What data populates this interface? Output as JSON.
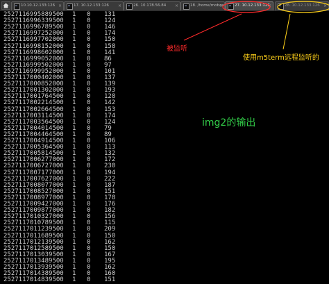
{
  "tabs": [
    {
      "label": "10.10.12.133:126",
      "active": false
    },
    {
      "label": "17. 10.12.133:126",
      "active": false
    },
    {
      "label": "26. 10.178.56.84",
      "active": false
    },
    {
      "label": "18. /home/mobaxterm",
      "active": false
    },
    {
      "label": "27. 10.12.133:126",
      "active": true
    },
    {
      "label": "28. 10.12.133.126",
      "active": false
    }
  ],
  "terminal": {
    "rows": [
      {
        "ts": "2527116995889500",
        "a": "1",
        "b": "0",
        "v": "131"
      },
      {
        "ts": "2527116996339500",
        "a": "1",
        "b": "0",
        "v": "124"
      },
      {
        "ts": "2527116996789500",
        "a": "1",
        "b": "0",
        "v": "146"
      },
      {
        "ts": "2527116997252000",
        "a": "1",
        "b": "0",
        "v": "174"
      },
      {
        "ts": "2527116997702000",
        "a": "1",
        "b": "0",
        "v": "150"
      },
      {
        "ts": "2527116998152000",
        "a": "1",
        "b": "0",
        "v": "158"
      },
      {
        "ts": "2527116998602000",
        "a": "1",
        "b": "0",
        "v": "141"
      },
      {
        "ts": "2527116999052000",
        "a": "1",
        "b": "0",
        "v": "86"
      },
      {
        "ts": "2527116999502000",
        "a": "1",
        "b": "0",
        "v": "97"
      },
      {
        "ts": "2527116999952000",
        "a": "1",
        "b": "0",
        "v": "101"
      },
      {
        "ts": "2527117000402000",
        "a": "1",
        "b": "0",
        "v": "137"
      },
      {
        "ts": "2527117000852000",
        "a": "1",
        "b": "0",
        "v": "139"
      },
      {
        "ts": "2527117001302000",
        "a": "1",
        "b": "0",
        "v": "193"
      },
      {
        "ts": "2527117001764500",
        "a": "1",
        "b": "0",
        "v": "128"
      },
      {
        "ts": "2527117002214500",
        "a": "1",
        "b": "0",
        "v": "142"
      },
      {
        "ts": "2527117002664500",
        "a": "1",
        "b": "0",
        "v": "153"
      },
      {
        "ts": "2527117003114500",
        "a": "1",
        "b": "0",
        "v": "174"
      },
      {
        "ts": "2527117003564500",
        "a": "1",
        "b": "0",
        "v": "124"
      },
      {
        "ts": "2527117004014500",
        "a": "1",
        "b": "0",
        "v": "79"
      },
      {
        "ts": "2527117004464500",
        "a": "1",
        "b": "0",
        "v": "89"
      },
      {
        "ts": "2527117004914500",
        "a": "1",
        "b": "0",
        "v": "106"
      },
      {
        "ts": "2527117005364500",
        "a": "1",
        "b": "0",
        "v": "113"
      },
      {
        "ts": "2527117005814500",
        "a": "1",
        "b": "0",
        "v": "132"
      },
      {
        "ts": "2527117006277000",
        "a": "1",
        "b": "0",
        "v": "172"
      },
      {
        "ts": "2527117006727000",
        "a": "1",
        "b": "0",
        "v": "230"
      },
      {
        "ts": "2527117007177000",
        "a": "1",
        "b": "0",
        "v": "194"
      },
      {
        "ts": "2527117007627000",
        "a": "1",
        "b": "0",
        "v": "222"
      },
      {
        "ts": "2527117008077000",
        "a": "1",
        "b": "0",
        "v": "187"
      },
      {
        "ts": "2527117008527000",
        "a": "1",
        "b": "0",
        "v": "151"
      },
      {
        "ts": "2527117008977000",
        "a": "1",
        "b": "0",
        "v": "178"
      },
      {
        "ts": "2527117009427000",
        "a": "1",
        "b": "0",
        "v": "176"
      },
      {
        "ts": "2527117009877000",
        "a": "1",
        "b": "0",
        "v": "182"
      },
      {
        "ts": "2527117010327000",
        "a": "1",
        "b": "0",
        "v": "156"
      },
      {
        "ts": "2527117010789500",
        "a": "1",
        "b": "0",
        "v": "115"
      },
      {
        "ts": "2527117011239500",
        "a": "1",
        "b": "0",
        "v": "209"
      },
      {
        "ts": "2527117011689500",
        "a": "1",
        "b": "0",
        "v": "150"
      },
      {
        "ts": "2527117012139500",
        "a": "1",
        "b": "0",
        "v": "162"
      },
      {
        "ts": "2527117012589500",
        "a": "1",
        "b": "0",
        "v": "150"
      },
      {
        "ts": "2527117013039500",
        "a": "1",
        "b": "0",
        "v": "167"
      },
      {
        "ts": "2527117013489500",
        "a": "1",
        "b": "0",
        "v": "195"
      },
      {
        "ts": "2527117013939500",
        "a": "1",
        "b": "0",
        "v": "162"
      },
      {
        "ts": "2527117014389500",
        "a": "1",
        "b": "0",
        "v": "160"
      },
      {
        "ts": "2527117014839500",
        "a": "1",
        "b": "0",
        "v": "151"
      }
    ]
  },
  "annotations": {
    "monitored_label": "被监听",
    "m5term_label": "使用m5term远程监听的",
    "output_label": "img2的输出",
    "colors": {
      "red": "#ff2b2b",
      "yellow": "#ffd11a",
      "green": "#33d14a"
    }
  }
}
